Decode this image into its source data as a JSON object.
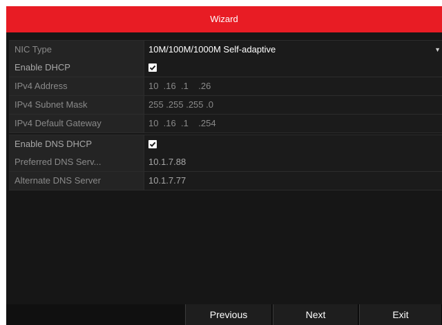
{
  "window": {
    "title": "Wizard"
  },
  "network": {
    "nic_type": {
      "label": "NIC Type",
      "value": "10M/100M/1000M Self-adaptive"
    },
    "enable_dhcp": {
      "label": "Enable DHCP",
      "checked": true
    },
    "ipv4_address": {
      "label": "IPv4 Address",
      "value": "10  .16  .1    .26"
    },
    "ipv4_subnet_mask": {
      "label": "IPv4 Subnet Mask",
      "value": "255 .255 .255 .0"
    },
    "ipv4_default_gateway": {
      "label": "IPv4 Default Gateway",
      "value": "10  .16  .1    .254"
    }
  },
  "dns": {
    "enable_dns_dhcp": {
      "label": "Enable DNS DHCP",
      "checked": true
    },
    "preferred_dns": {
      "label": "Preferred DNS Serv...",
      "value": "10.1.7.88"
    },
    "alternate_dns": {
      "label": "Alternate DNS Server",
      "value": "10.1.7.77"
    }
  },
  "buttons": {
    "previous": "Previous",
    "next": "Next",
    "exit": "Exit"
  },
  "colors": {
    "title_bar": "#e81c24",
    "background": "#161616",
    "row_label_bg": "#242424"
  },
  "icons": {
    "dropdown": "chevron-down-icon",
    "checkbox": "checkmark-icon"
  }
}
